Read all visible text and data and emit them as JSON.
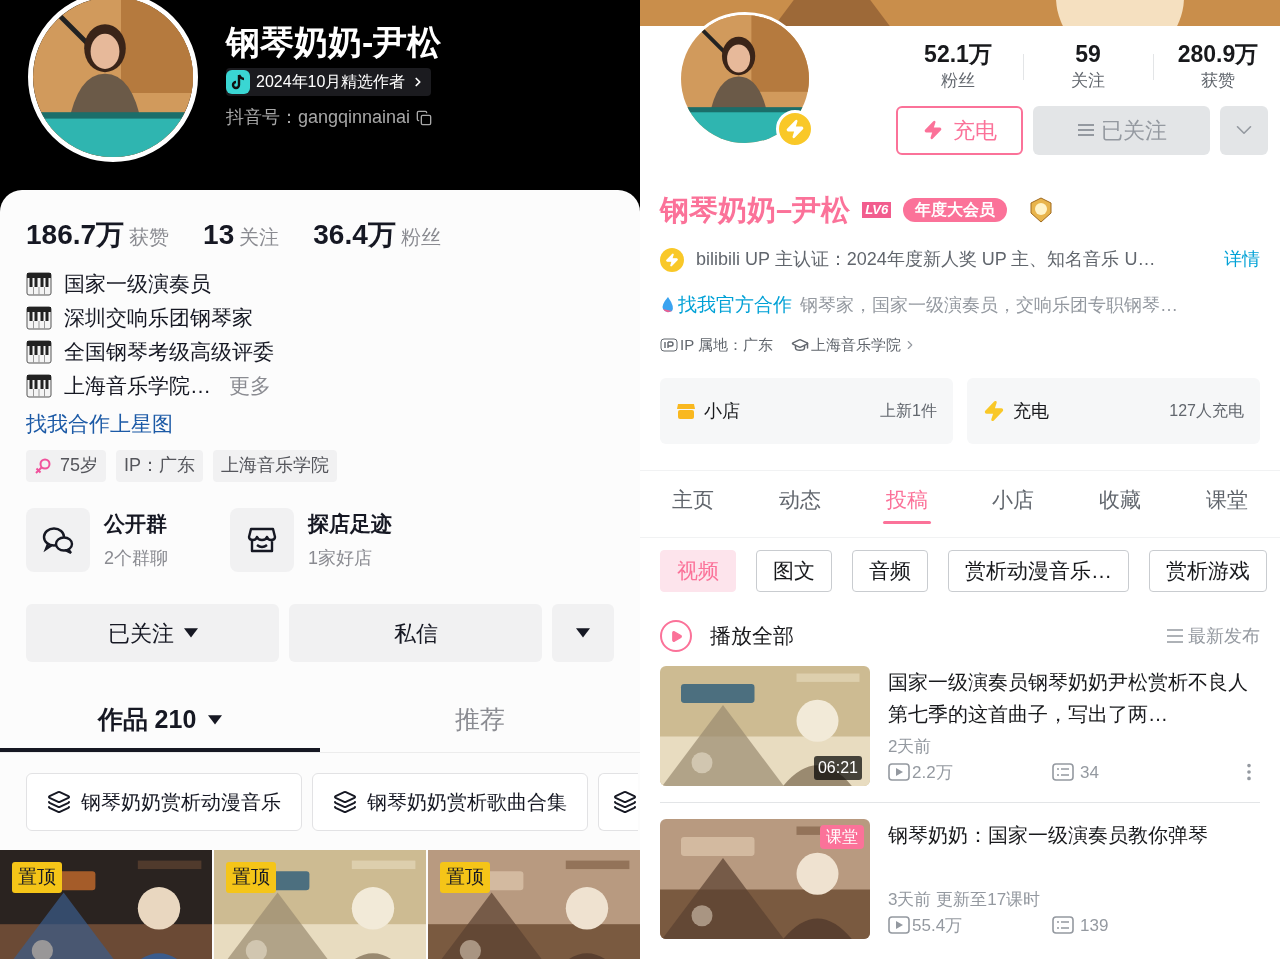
{
  "douyin": {
    "name": "钢琴奶奶-尹松",
    "award": "2024年10月精选作者",
    "account": "抖音号：gangqinnainai",
    "stats": [
      {
        "number": "186.7万",
        "caption": "获赞"
      },
      {
        "number": "13",
        "caption": "关注"
      },
      {
        "number": "36.4万",
        "caption": "粉丝"
      }
    ],
    "bio": [
      {
        "text": "国家一级演奏员"
      },
      {
        "text": "深圳交响乐团钢琴家"
      },
      {
        "text": "全国钢琴考级高级评委"
      },
      {
        "text": "上海音乐学院…",
        "more": "更多"
      }
    ],
    "link": "找我合作上星图",
    "tags": [
      {
        "kind": "age",
        "text": "75岁"
      },
      {
        "kind": "plain",
        "text": "IP：广东"
      },
      {
        "kind": "plain",
        "text": "上海音乐学院"
      }
    ],
    "features": [
      {
        "kind": "group",
        "title": "公开群",
        "subtitle": "2个群聊"
      },
      {
        "kind": "shop",
        "title": "探店足迹",
        "subtitle": "1家好店"
      }
    ],
    "actions": {
      "follow": "已关注",
      "message": "私信"
    },
    "tabs": [
      {
        "label": "作品 210",
        "dropdown": true,
        "selected": true
      },
      {
        "label": "推荐",
        "dropdown": false,
        "selected": false
      }
    ],
    "collections": [
      "钢琴奶奶赏析动漫音乐",
      "钢琴奶奶赏析歌曲合集"
    ],
    "videos": [
      {
        "badge": "置顶"
      },
      {
        "badge": "置顶"
      },
      {
        "badge": "置顶"
      }
    ]
  },
  "bilibili": {
    "stats": [
      {
        "value": "52.1万",
        "label": "粉丝"
      },
      {
        "value": "59",
        "label": "关注"
      },
      {
        "value": "280.9万",
        "label": "获赞"
      }
    ],
    "charge": "充电",
    "follow": "已关注",
    "name": "钢琴奶奶–尹松",
    "level": "LV6",
    "vip": "年度大会员",
    "certification": "bilibili UP 主认证：2024年度新人奖 UP 主、知名音乐 U…",
    "details": "详情",
    "cooperation": {
      "link": "找我官方合作",
      "text": "钢琴家，国家一级演奏员，交响乐团专职钢琴…"
    },
    "ip": "IP 属地：广东",
    "school": "上海音乐学院",
    "cards": [
      {
        "kind": "shop",
        "title": "小店",
        "info": "上新1件"
      },
      {
        "kind": "charge",
        "title": "充电",
        "info": "127人充电"
      }
    ],
    "tabs": [
      {
        "label": "主页",
        "selected": false
      },
      {
        "label": "动态",
        "selected": false
      },
      {
        "label": "投稿",
        "selected": true
      },
      {
        "label": "小店",
        "selected": false
      },
      {
        "label": "收藏",
        "selected": false
      },
      {
        "label": "课堂",
        "selected": false
      }
    ],
    "filters": [
      {
        "label": "视频",
        "selected": true
      },
      {
        "label": "图文",
        "selected": false
      },
      {
        "label": "音频",
        "selected": false
      },
      {
        "label": "赏析动漫音乐…",
        "selected": false
      },
      {
        "label": "赏析游戏",
        "selected": false
      }
    ],
    "play_all": "播放全部",
    "sort": "最新发布",
    "videos": [
      {
        "title": "国家一级演奏员钢琴奶奶尹松赏析不良人第七季的这首曲子，写出了两…",
        "duration": "06:21",
        "date": "2天前",
        "views": "2.2万",
        "comments": "34"
      },
      {
        "title": "钢琴奶奶：国家一级演奏员教你弹琴",
        "badge": "课堂",
        "date": "3天前 更新至17课时",
        "views": "55.4万",
        "comments": "139"
      }
    ]
  }
}
